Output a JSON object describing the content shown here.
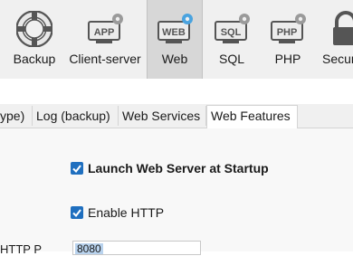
{
  "toolbar": {
    "items": [
      {
        "label": "Backup",
        "icon": "lifebuoy-icon"
      },
      {
        "label": "Client-server",
        "icon": "app-gear-icon"
      },
      {
        "label": "Web",
        "icon": "web-gear-icon",
        "active": true
      },
      {
        "label": "SQL",
        "icon": "sql-gear-icon"
      },
      {
        "label": "PHP",
        "icon": "php-gear-icon"
      },
      {
        "label": "Secur",
        "icon": "lock-icon"
      }
    ]
  },
  "icon_text": {
    "app": "APP",
    "web": "WEB",
    "sql": "SQL",
    "php": "PHP"
  },
  "tabs": [
    {
      "label": "ype)"
    },
    {
      "label": "Log (backup)"
    },
    {
      "label": "Web Services"
    },
    {
      "label": "Web Features"
    }
  ],
  "options": {
    "launch_label": "Launch Web Server at Startup",
    "launch_checked": true,
    "http_label": "Enable HTTP",
    "http_checked": true
  },
  "http_port": {
    "label": "HTTP P",
    "value": "8080"
  },
  "colors": {
    "accent": "#1f6fbf",
    "gear": "#4aa3df",
    "active_tab_bg": "#d7d7d7"
  }
}
